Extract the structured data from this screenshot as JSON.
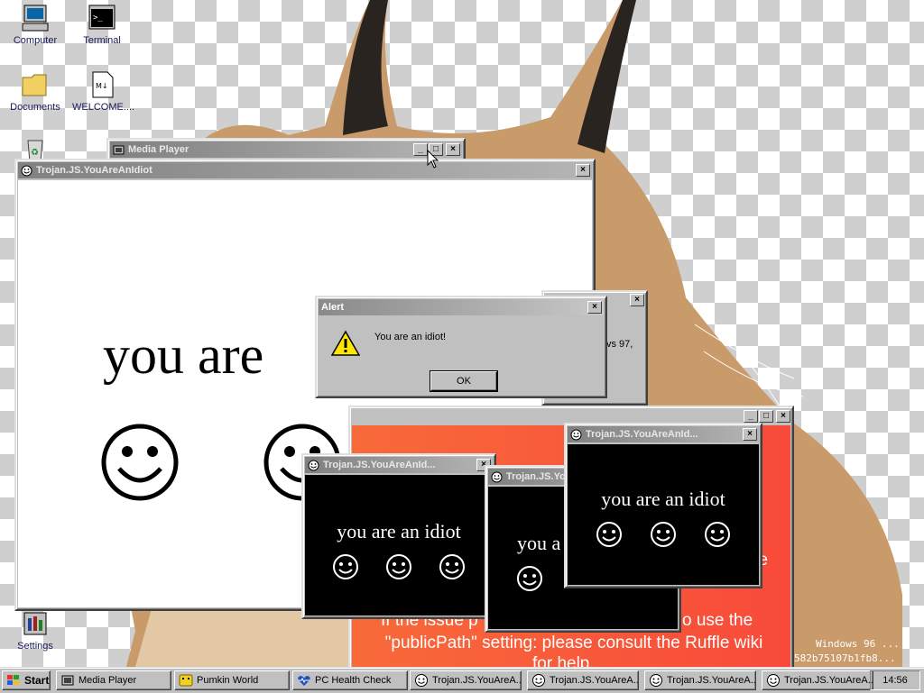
{
  "desktop": {
    "icons": [
      {
        "label": "Computer"
      },
      {
        "label": "Terminal"
      },
      {
        "label": "Documents"
      },
      {
        "label": "WELCOME...."
      },
      {
        "label": "Settings"
      }
    ],
    "watermark": "Windows 96 ...",
    "watermark_hash": "582b75107b1fb8..."
  },
  "windows": {
    "media_player": {
      "title": "Media Player"
    },
    "main_idiot": {
      "title": "Trojan.JS.YouAreAnIdiot",
      "text": "you are"
    },
    "hidden_dialog": {
      "snippet": "vs 97,"
    },
    "ruffle": {
      "line1": "re",
      "line2": "If the issue p",
      "line2b": "o use the",
      "line3": "\"publicPath\" setting: please consult the Ruffle wiki",
      "line4": "for help."
    },
    "idiot1": {
      "title": "Trojan.JS.YouAreAnId...",
      "text": "you are an idiot"
    },
    "idiot2": {
      "title": "Trojan.JS.YouAre...",
      "text": "you a"
    },
    "idiot3": {
      "title": "Trojan.JS.YouAreAnId...",
      "text": "you are an idiot"
    },
    "alert": {
      "title": "Alert",
      "message": "You are an idiot!",
      "ok": "OK"
    }
  },
  "taskbar": {
    "start": "Start",
    "items": [
      {
        "label": "Media Player"
      },
      {
        "label": "Pumkin World"
      },
      {
        "label": "PC Health Check"
      },
      {
        "label": "Trojan.JS.YouAreA..."
      },
      {
        "label": "Trojan.JS.YouAreA..."
      },
      {
        "label": "Trojan.JS.YouAreA..."
      },
      {
        "label": "Trojan.JS.YouAreA..."
      }
    ],
    "clock": "14:56"
  },
  "colors": {
    "ruffle_bg": "#f8523a",
    "titlebar": "#808080",
    "window_face": "#c0c0c0"
  }
}
